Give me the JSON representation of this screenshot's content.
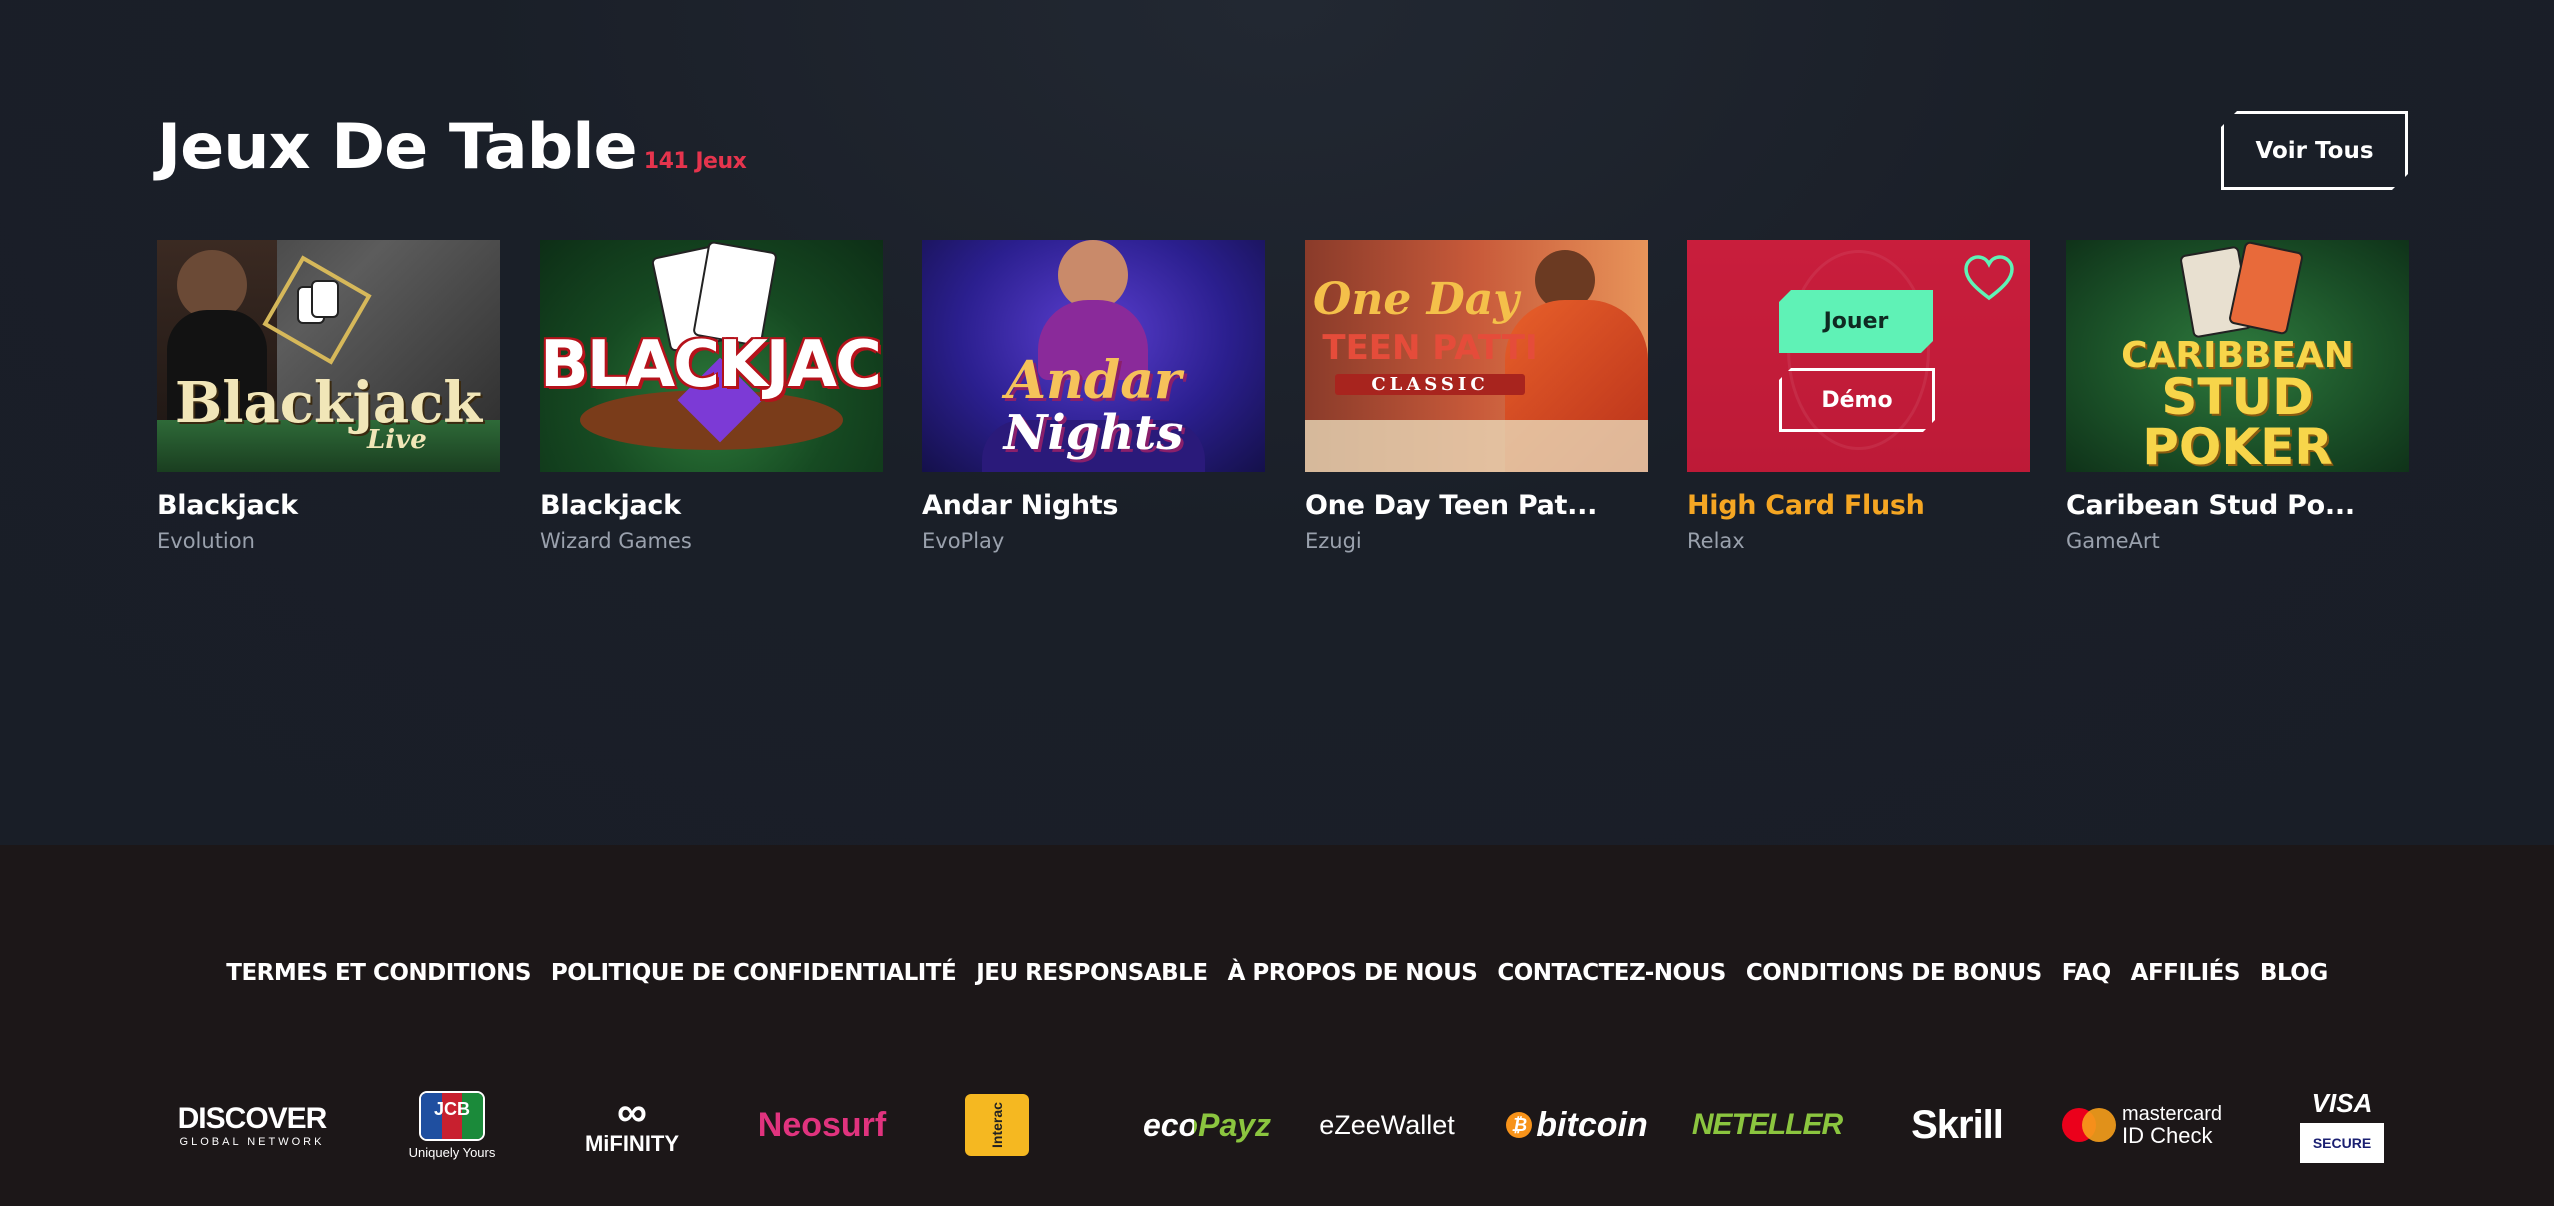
{
  "section": {
    "title": "Jeux De Table",
    "count": "141 Jeux",
    "view_all": "Voir Tous"
  },
  "games": [
    {
      "name": "Blackjack",
      "provider": "Evolution",
      "thumb_text": [
        "Blackjack",
        "Live"
      ]
    },
    {
      "name": "Blackjack",
      "provider": "Wizard Games",
      "thumb_text": [
        "BLACKJACK"
      ]
    },
    {
      "name": "Andar Nights",
      "provider": "EvoPlay",
      "thumb_text": [
        "Andar",
        "Nights"
      ]
    },
    {
      "name": "One Day Teen Pat...",
      "provider": "Ezugi",
      "thumb_text": [
        "One Day",
        "TEEN PATTI",
        "CLASSIC"
      ]
    },
    {
      "name": "High Card Flush",
      "provider": "Relax",
      "play_label": "Jouer",
      "demo_label": "Démo",
      "highlighted": true
    },
    {
      "name": "Caribean Stud Po...",
      "provider": "GameArt",
      "thumb_text": [
        "CARIBBEAN",
        "STUD",
        "POKER"
      ]
    }
  ],
  "footer": {
    "links": [
      "TERMES ET CONDITIONS",
      "POLITIQUE DE CONFIDENTIALITÉ",
      "JEU RESPONSABLE",
      "À PROPOS DE NOUS",
      "CONTACTEZ-NOUS",
      "CONDITIONS DE BONUS",
      "FAQ",
      "AFFILIÉS",
      "BLOG"
    ],
    "payments": {
      "discover": "DISCOVER",
      "discover_sub": "GLOBAL NETWORK",
      "jcb": "JCB",
      "jcb_sub": "Uniquely Yours",
      "mifinity": "MiFINITY",
      "neosurf": "Neosurf",
      "interac": "Interac",
      "ecopayz": "ecoPayz",
      "ezeewallet": "eZeeWallet",
      "bitcoin": "bitcoin",
      "neteller": "NETELLER",
      "skrill": "Skrill",
      "mastercard": "mastercard",
      "mastercard_sub": "ID Check",
      "visa": "VISA",
      "visa_sub": "SECURE"
    }
  },
  "colors": {
    "accent_red": "#e5344d",
    "highlight_orange": "#f5a623",
    "play_green": "#5ff2b6"
  }
}
